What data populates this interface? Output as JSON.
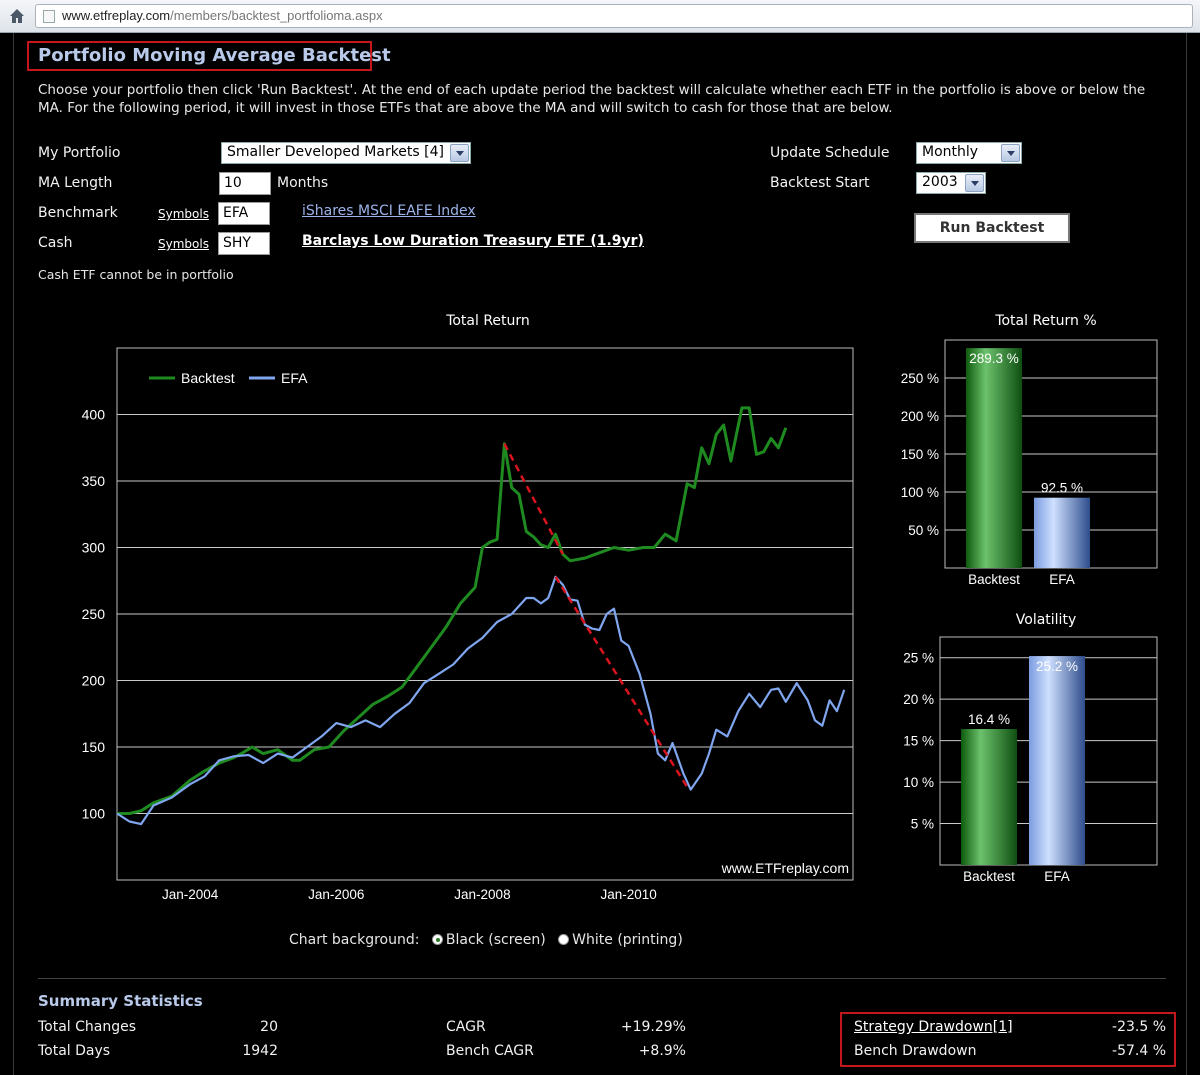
{
  "browser": {
    "url_domain": "www.etfreplay.com",
    "url_path": "/members/backtest_portfolioma.aspx"
  },
  "page": {
    "title": "Portfolio Moving Average Backtest",
    "intro": "Choose your portfolio then click 'Run Backtest'. At the end of each update period the backtest will calculate whether each ETF in the portfolio is above or below the MA. For the following period, it will invest in those ETFs that are above the MA and will switch to cash for those that are below."
  },
  "form": {
    "portfolio_label": "My Portfolio",
    "portfolio_value": "Smaller Developed Markets [4]",
    "ma_label": "MA Length",
    "ma_value": "10",
    "ma_unit": "Months",
    "benchmark_label": "Benchmark",
    "benchmark_symbols": "Symbols",
    "benchmark_value": "EFA",
    "benchmark_name": "iShares MSCI EAFE Index",
    "cash_label": "Cash",
    "cash_symbols": "Symbols",
    "cash_value": "SHY",
    "cash_name": "Barclays Low Duration Treasury ETF (1.9yr)",
    "cash_note": "Cash ETF cannot be in portfolio",
    "update_label": "Update Schedule",
    "update_value": "Monthly",
    "start_label": "Backtest Start",
    "start_value": "2003",
    "run_button": "Run Backtest"
  },
  "chart_options": {
    "label": "Chart background:",
    "option_black": "Black (screen)",
    "option_white": "White (printing)",
    "selected": "black"
  },
  "colors": {
    "backtest": "#1f8a1f",
    "efa": "#7fa6ee",
    "drawdown": "#d9141e",
    "highlight": "#c4161c",
    "heading": "#b9c9ea"
  },
  "chart_data": [
    {
      "type": "line",
      "title": "Total Return",
      "watermark": "www.ETFreplay.com",
      "x_ticks": [
        "Jan-2004",
        "Jan-2006",
        "Jan-2008",
        "Jan-2010"
      ],
      "y_ticks": [
        100,
        150,
        200,
        250,
        300,
        350,
        400
      ],
      "ylim": [
        50,
        450
      ],
      "legend": "top-left",
      "series": [
        {
          "name": "Backtest",
          "points": [
            [
              2003.0,
              100
            ],
            [
              2003.17,
              100
            ],
            [
              2003.33,
              102
            ],
            [
              2003.5,
              108
            ],
            [
              2003.75,
              113
            ],
            [
              2004.0,
              125
            ],
            [
              2004.2,
              132
            ],
            [
              2004.4,
              138
            ],
            [
              2004.6,
              142
            ],
            [
              2004.7,
              145
            ],
            [
              2004.85,
              150
            ],
            [
              2005.0,
              145
            ],
            [
              2005.2,
              148
            ],
            [
              2005.4,
              140
            ],
            [
              2005.5,
              140
            ],
            [
              2005.7,
              148
            ],
            [
              2005.9,
              150
            ],
            [
              2006.1,
              162
            ],
            [
              2006.3,
              172
            ],
            [
              2006.5,
              182
            ],
            [
              2006.7,
              188
            ],
            [
              2006.9,
              195
            ],
            [
              2007.1,
              210
            ],
            [
              2007.3,
              225
            ],
            [
              2007.5,
              240
            ],
            [
              2007.7,
              258
            ],
            [
              2007.9,
              270
            ],
            [
              2008.0,
              300
            ],
            [
              2008.1,
              304
            ],
            [
              2008.2,
              306
            ],
            [
              2008.3,
              378
            ],
            [
              2008.4,
              345
            ],
            [
              2008.5,
              340
            ],
            [
              2008.6,
              312
            ],
            [
              2008.7,
              308
            ],
            [
              2008.8,
              302
            ],
            [
              2008.9,
              300
            ],
            [
              2009.0,
              310
            ],
            [
              2009.1,
              295
            ],
            [
              2009.2,
              290
            ],
            [
              2009.4,
              292
            ],
            [
              2009.6,
              296
            ],
            [
              2009.8,
              300
            ],
            [
              2010.0,
              298
            ],
            [
              2010.2,
              300
            ],
            [
              2010.35,
              300
            ],
            [
              2010.5,
              310
            ],
            [
              2010.65,
              305
            ],
            [
              2010.8,
              348
            ],
            [
              2010.9,
              345
            ],
            [
              2011.0,
              375
            ],
            [
              2011.1,
              363
            ],
            [
              2011.2,
              385
            ],
            [
              2011.3,
              392
            ],
            [
              2011.4,
              365
            ],
            [
              2011.55,
              405
            ],
            [
              2011.65,
              405
            ],
            [
              2011.75,
              370
            ],
            [
              2011.85,
              372
            ],
            [
              2011.95,
              382
            ],
            [
              2012.05,
              375
            ],
            [
              2012.15,
              390
            ]
          ]
        },
        {
          "name": "EFA",
          "points": [
            [
              2003.0,
              100
            ],
            [
              2003.17,
              94
            ],
            [
              2003.33,
              92
            ],
            [
              2003.5,
              106
            ],
            [
              2003.75,
              112
            ],
            [
              2004.0,
              122
            ],
            [
              2004.2,
              128
            ],
            [
              2004.4,
              140
            ],
            [
              2004.6,
              143
            ],
            [
              2004.8,
              144
            ],
            [
              2005.0,
              138
            ],
            [
              2005.2,
              145
            ],
            [
              2005.4,
              142
            ],
            [
              2005.6,
              150
            ],
            [
              2005.8,
              158
            ],
            [
              2006.0,
              168
            ],
            [
              2006.2,
              165
            ],
            [
              2006.4,
              170
            ],
            [
              2006.6,
              165
            ],
            [
              2006.8,
              175
            ],
            [
              2007.0,
              183
            ],
            [
              2007.2,
              198
            ],
            [
              2007.4,
              205
            ],
            [
              2007.6,
              212
            ],
            [
              2007.8,
              224
            ],
            [
              2008.0,
              232
            ],
            [
              2008.2,
              244
            ],
            [
              2008.4,
              250
            ],
            [
              2008.6,
              262
            ],
            [
              2008.7,
              262
            ],
            [
              2008.8,
              258
            ],
            [
              2008.9,
              262
            ],
            [
              2009.0,
              278
            ],
            [
              2009.1,
              272
            ],
            [
              2009.2,
              261
            ],
            [
              2009.3,
              260
            ],
            [
              2009.4,
              242
            ],
            [
              2009.5,
              239
            ],
            [
              2009.6,
              238
            ],
            [
              2009.7,
              250
            ],
            [
              2009.8,
              254
            ],
            [
              2009.9,
              230
            ],
            [
              2010.0,
              226
            ],
            [
              2010.15,
              205
            ],
            [
              2010.3,
              175
            ],
            [
              2010.4,
              145
            ],
            [
              2010.5,
              140
            ],
            [
              2010.6,
              153
            ],
            [
              2010.75,
              130
            ],
            [
              2010.85,
              118
            ],
            [
              2011.0,
              130
            ],
            [
              2011.1,
              145
            ],
            [
              2011.2,
              163
            ],
            [
              2011.35,
              158
            ],
            [
              2011.5,
              177
            ],
            [
              2011.65,
              190
            ],
            [
              2011.8,
              180
            ],
            [
              2011.95,
              193
            ],
            [
              2012.05,
              194
            ],
            [
              2012.15,
              184
            ],
            [
              2012.3,
              198
            ],
            [
              2012.45,
              185
            ],
            [
              2012.55,
              170
            ],
            [
              2012.65,
              166
            ],
            [
              2012.75,
              185
            ],
            [
              2012.85,
              177
            ],
            [
              2012.95,
              193
            ]
          ]
        }
      ],
      "drawdowns": [
        {
          "series": "Backtest",
          "from": [
            2008.3,
            378
          ],
          "to": [
            2009.1,
            295
          ]
        },
        {
          "series": "EFA",
          "from": [
            2009.0,
            278
          ],
          "to": [
            2010.8,
            120
          ]
        }
      ]
    },
    {
      "type": "bar",
      "title": "Total Return %",
      "categories": [
        "Backtest",
        "EFA"
      ],
      "values": [
        289.3,
        92.5
      ],
      "labels": [
        "289.3 %",
        "92.5 %"
      ],
      "y_ticks": [
        "50 %",
        "100 %",
        "150 %",
        "200 %",
        "250 %"
      ],
      "ylim": [
        0,
        300
      ]
    },
    {
      "type": "bar",
      "title": "Volatility",
      "categories": [
        "Backtest",
        "EFA"
      ],
      "values": [
        16.4,
        25.2
      ],
      "labels": [
        "16.4 %",
        "25.2 %"
      ],
      "y_ticks": [
        "5 %",
        "10 %",
        "15 %",
        "20 %",
        "25 %"
      ],
      "ylim": [
        0,
        27.5
      ]
    }
  ],
  "summary": {
    "title": "Summary Statistics",
    "total_changes_label": "Total Changes",
    "total_changes": "20",
    "total_days_label": "Total Days",
    "total_days": "1942",
    "cagr_label": "CAGR",
    "cagr": "+19.29%",
    "bench_cagr_label": "Bench CAGR",
    "bench_cagr": "+8.9%",
    "strategy_dd_label": "Strategy Drawdown[1]",
    "strategy_dd": "-23.5 %",
    "bench_dd_label": "Bench Drawdown",
    "bench_dd": "-57.4 %"
  }
}
